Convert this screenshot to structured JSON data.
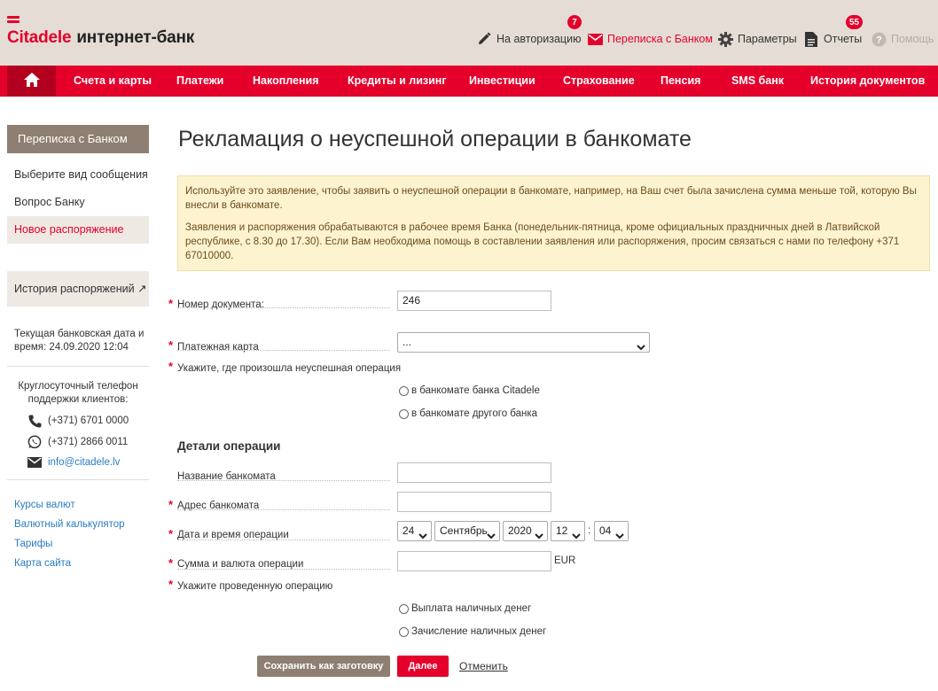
{
  "header": {
    "brand": "Citadele",
    "product": "интернет-банк",
    "tools": {
      "authorization": {
        "label": "На авторизацию",
        "badge": "7"
      },
      "messages": {
        "label": "Переписка с Банком"
      },
      "settings": {
        "label": "Параметры"
      },
      "reports": {
        "label": "Отчеты",
        "badge": "55"
      },
      "help": {
        "label": "Помощь"
      }
    }
  },
  "nav": {
    "items": [
      "Счета и карты",
      "Платежи",
      "Накопления",
      "Кредиты и лизинг",
      "Инвестиции",
      "Страхование",
      "Пенсия",
      "SMS банк",
      "История документов"
    ]
  },
  "sidebar": {
    "title": "Переписка с Банком",
    "links": [
      "Выберите вид сообщения",
      "Вопрос Банку",
      "Новое распоряжение"
    ],
    "history": "История распоряжений ↗",
    "bank_date": "Текущая банковская дата и время: 24.09.2020 12:04",
    "support_title": "Круглосуточный телефон поддержки клиентов:",
    "phone": "(+371) 6701 0000",
    "whatsapp": "(+371) 2866 0011",
    "email": "info@citadele.lv",
    "quick_links": [
      "Курсы валют",
      "Валютный калькулятор",
      "Тарифы",
      "Карта сайта"
    ]
  },
  "page": {
    "title": "Рекламация о неуспешной операции в банкомате",
    "notice_1": "Используйте это заявление, чтобы заявить о неуспешной операции в банкомате, например, на Ваш счет была зачислена сумма меньше той, которую Вы внесли в банкомате.",
    "notice_2": "Заявления и распоряжения обрабатываются в рабочее время Банка (понедельник-пятница, кроме официальных праздничных дней в Латвийской республике, с 8.30 до 17.30). Если Вам необходима помощь в составлении заявления или распоряжения, просим связаться с нами по телефону +371 67010000."
  },
  "form": {
    "doc_number_label": "Номер документа:",
    "doc_number_value": "246",
    "card_label": "Платежная карта",
    "card_value": "...",
    "location_label": "Укажите, где произошла неуспешная операция",
    "location_options": [
      "в банкомате банка Citadele",
      "в банкомате другого банка"
    ],
    "details_title": "Детали операции",
    "atm_name_label": "Название банкомата",
    "atm_address_label": "Адрес банкомата",
    "datetime_label": "Дата и время операции",
    "day": "24",
    "month": "Сентябрь",
    "year": "2020",
    "hour": "12",
    "time_sep": ":",
    "minute": "04",
    "amount_label": "Сумма и валюта операции",
    "currency": "EUR",
    "operation_label": "Укажите проведенную операцию",
    "operation_options": [
      "Выплата наличных денег",
      "Зачисление наличных денег"
    ],
    "required_mark": "*"
  },
  "buttons": {
    "save_draft": "Сохранить как заготовку",
    "next": "Далее",
    "cancel": "Отменить"
  },
  "colors": {
    "brand_red": "#e4002b",
    "header_bg": "#e5ddd5",
    "sidebar_head": "#8e7f72",
    "notice_bg": "#fdf3cf"
  }
}
